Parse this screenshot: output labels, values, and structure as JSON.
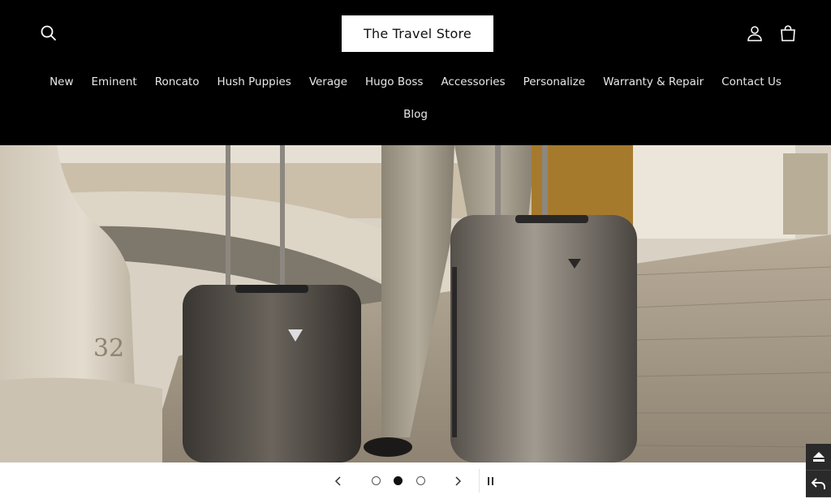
{
  "header": {
    "logo_text": "The Travel Store",
    "nav_row1": [
      "New",
      "Eminent",
      "Roncato",
      "Hush Puppies",
      "Verage",
      "Hugo Boss",
      "Accessories",
      "Personalize",
      "Warranty & Repair",
      "Contact Us"
    ],
    "nav_row2": [
      "Blog"
    ],
    "icons": {
      "search": "search-icon",
      "account": "account-icon",
      "cart": "cart-icon"
    }
  },
  "hero": {
    "image": "hero-luggage-photo"
  },
  "slider": {
    "slide_count": 3,
    "active_index": 1,
    "icons": {
      "prev": "chevron-left-icon",
      "next": "chevron-right-icon",
      "pause": "pause-icon"
    }
  },
  "side_tools": {
    "icons": [
      "eject-icon",
      "undo-icon"
    ]
  },
  "colors": {
    "header_bg": "#000000",
    "logo_bg": "#ffffff",
    "controls_bg": "#ffffff",
    "side_tool_bg": "#2a2a2a"
  }
}
